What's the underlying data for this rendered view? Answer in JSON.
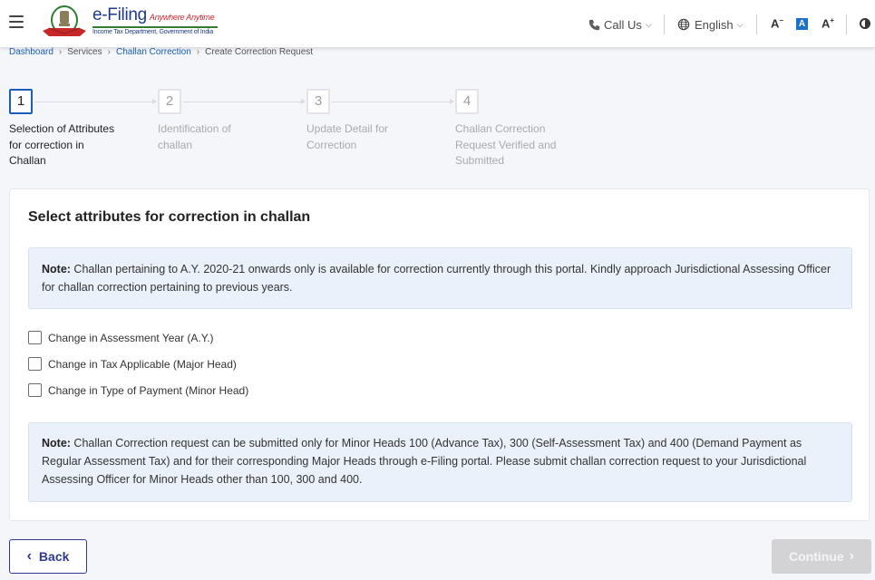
{
  "header": {
    "logo": {
      "title": "e-Filing",
      "tagline": "Anywhere Anytime",
      "subtitle": "Income Tax Department, Government of India"
    },
    "call_us_label": "Call Us",
    "language_label": "English",
    "font_decrease_label": "A",
    "font_default_label": "A",
    "font_increase_label": "A",
    "colors": {
      "brand_blue": "#1b3b8c",
      "tagline_red": "#d0232a",
      "accent_blue": "#1a73c9"
    }
  },
  "breadcrumb": [
    {
      "label": "Dashboard",
      "link": true
    },
    {
      "label": "Services",
      "link": false
    },
    {
      "label": "Challan Correction",
      "link": true
    },
    {
      "label": "Create Correction Request",
      "link": false
    }
  ],
  "stepper": {
    "steps": [
      {
        "number": "1",
        "label": "Selection of Attributes for correction in Challan",
        "active": true
      },
      {
        "number": "2",
        "label": "Identification of challan",
        "active": false
      },
      {
        "number": "3",
        "label": "Update Detail for Correction",
        "active": false
      },
      {
        "number": "4",
        "label": "Challan Correction Request Verified and Submitted",
        "active": false
      }
    ]
  },
  "card": {
    "title": "Select attributes for correction in challan",
    "note1": {
      "prefix": "Note:",
      "text": " Challan pertaining to A.Y. 2020-21 onwards only is available for correction currently through this portal. Kindly approach Jurisdictional Assessing Officer for challan correction pertaining to previous years."
    },
    "checkboxes": [
      {
        "label": "Change in Assessment Year (A.Y.)",
        "checked": false
      },
      {
        "label": "Change in Tax Applicable (Major Head)",
        "checked": false
      },
      {
        "label": "Change in Type of Payment (Minor Head)",
        "checked": false
      }
    ],
    "note2": {
      "prefix": "Note:",
      "text": " Challan Correction request can be submitted only for Minor Heads 100 (Advance Tax), 300 (Self-Assessment Tax) and 400 (Demand Payment as Regular Assessment Tax) and for their corresponding Major Heads through e-Filing portal. Please submit challan correction request to your Jurisdictional Assessing Officer for Minor Heads other than 100, 300 and 400."
    }
  },
  "actions": {
    "back_label": "Back",
    "continue_label": "Continue",
    "continue_disabled": true
  }
}
